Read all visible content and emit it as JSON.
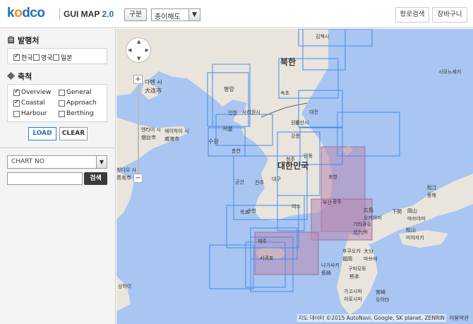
{
  "header": {
    "logo_prefix": "k",
    "logo_o": "o",
    "logo_suffix": "dco",
    "app_title": "GUI MAP",
    "app_version": "2.0",
    "gubun_label": "구분",
    "map_type_selected": "종이해도",
    "route_search_label": "항로검색",
    "cart_label": "장바구니"
  },
  "sidebar": {
    "publisher_title": "발행처",
    "publishers": [
      {
        "label": "한국",
        "checked": true
      },
      {
        "label": "영국",
        "checked": false
      },
      {
        "label": "일본",
        "checked": false
      }
    ],
    "scale_title": "축척",
    "scales": [
      {
        "label": "Overview",
        "checked": true
      },
      {
        "label": "General",
        "checked": false
      },
      {
        "label": "Coastal",
        "checked": true
      },
      {
        "label": "Approach",
        "checked": false
      },
      {
        "label": "Harbour",
        "checked": false
      },
      {
        "label": "Berthing",
        "checked": false
      }
    ],
    "load_label": "LOAD",
    "clear_label": "CLEAR",
    "chart_select_value": "CHART NO",
    "search_button_label": "검색"
  },
  "map": {
    "copyright": "지도 데이터 ©2015 AutoNavi, Google, SK planet, ZENRIN",
    "terms": "이용약관",
    "labels": [
      "북한",
      "대한민국",
      "평양",
      "서울",
      "인천",
      "수원",
      "춘천",
      "원주",
      "강릉",
      "원산시",
      "속초",
      "대전",
      "대구",
      "포항",
      "광주",
      "목포",
      "순천",
      "여수",
      "제주",
      "서귀포",
      "부산",
      "군산",
      "전주",
      "청주",
      "안동",
      "사리원시",
      "김책시",
      "다롄 시",
      "大连市",
      "엔타이 시",
      "烟台市",
      "웨이하이 시",
      "威海市",
      "칭다오 시",
      "青岛市",
      "상하이",
      "기타큐슈",
      "北九州",
      "후쿠오카",
      "福岡",
      "구마모토",
      "熊本",
      "나가사키",
      "長崎",
      "가고시마",
      "히로시마",
      "広島",
      "오카야마",
      "岡山",
      "마쓰야마",
      "松山",
      "미야자키",
      "宮崎",
      "오이타",
      "大分",
      "마쓰에",
      "松江",
      "동해",
      "시모노세키",
      "下関"
    ],
    "colors": {
      "sea": "#a9c5f1",
      "land": "#e9e5dc",
      "chart_blue": "#3f8cf0",
      "chart_purple_fill": "#b888b0"
    }
  }
}
